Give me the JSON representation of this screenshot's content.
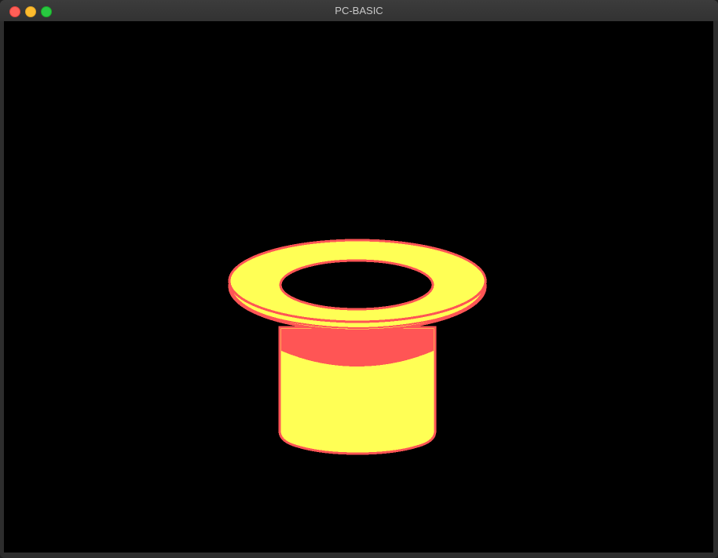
{
  "window": {
    "title": "PC-BASIC"
  },
  "colors": {
    "screen_bg": "#000000",
    "hat_fill": "#FFFF55",
    "hat_outline": "#FF5555",
    "hat_band": "#FF5555"
  },
  "graphics": {
    "subject": "top-hat-icon"
  }
}
